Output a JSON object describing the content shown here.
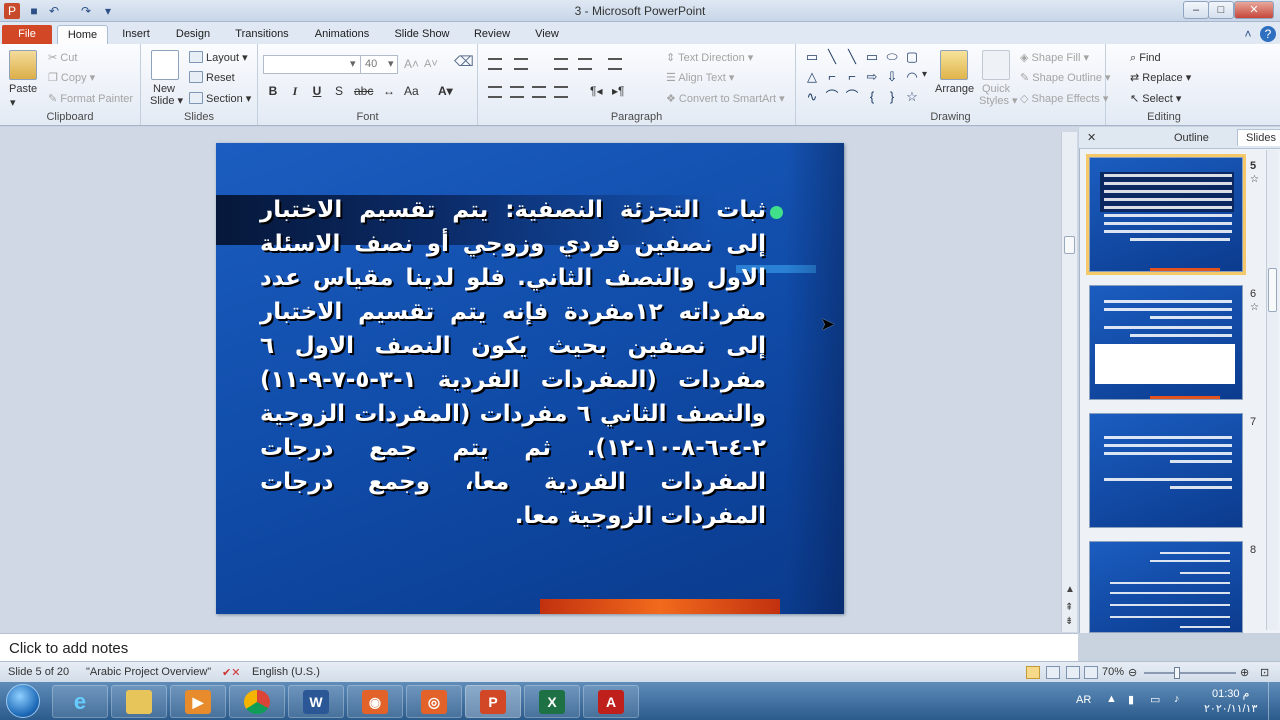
{
  "window": {
    "title": "3 - Microsoft PowerPoint",
    "minimize": "–",
    "maximize": "□",
    "close": "✕"
  },
  "tabs": [
    "File",
    "Home",
    "Insert",
    "Design",
    "Transitions",
    "Animations",
    "Slide Show",
    "Review",
    "View"
  ],
  "ribbon": {
    "clipboard": {
      "label": "Clipboard",
      "paste": "Paste",
      "cut": "Cut",
      "copy": "Copy",
      "format_painter": "Format Painter"
    },
    "slides": {
      "label": "Slides",
      "new_slide_1": "New",
      "new_slide_2": "Slide",
      "layout": "Layout",
      "reset": "Reset",
      "section": "Section"
    },
    "font": {
      "label": "Font",
      "font_name": "",
      "font_size": "40"
    },
    "paragraph": {
      "label": "Paragraph",
      "text_direction": "Text Direction",
      "align_text": "Align Text",
      "smartart": "Convert to SmartArt"
    },
    "drawing": {
      "label": "Drawing",
      "arrange": "Arrange",
      "quick_styles_1": "Quick",
      "quick_styles_2": "Styles",
      "shape_fill": "Shape Fill",
      "shape_outline": "Shape Outline",
      "shape_effects": "Shape Effects"
    },
    "editing": {
      "label": "Editing",
      "find": "Find",
      "replace": "Replace",
      "select": "Select"
    }
  },
  "slide": {
    "text": "ثبات التجزئة النصفية: يتم تقسيم الاختبار إلى نصفين فردي وزوجي أو نصف الاسئلة الاول والنصف الثاني. فلو لدينا مقياس عدد مفرداته ١٢مفردة فإنه يتم تقسيم الاختبار إلى نصفين بحيث يكون النصف الاول ٦ مفردات (المفردات الفردية ١-٣-٥-٧-٩-١١) والنصف الثاني ٦ مفردات (المفردات الزوجية ٢-٤-٦-٨-١٠-١٢). ثم يتم جمع درجات المفردات الفردية معا، وجمع درجات المفردات الزوجية معا."
  },
  "panel": {
    "tab_outline": "Outline",
    "tab_slides": "Slides",
    "close": "✕"
  },
  "thumbnails": [
    {
      "num": "5",
      "selected": true
    },
    {
      "num": "6",
      "selected": false
    },
    {
      "num": "7",
      "selected": false
    },
    {
      "num": "8",
      "selected": false
    }
  ],
  "notes": {
    "placeholder": "Click to add notes"
  },
  "status": {
    "slide_of": "Slide 5 of 20",
    "theme": "\"Arabic Project Overview\"",
    "language": "English (U.S.)",
    "zoom": "70%"
  },
  "tray": {
    "lang": "AR",
    "time": "01:30 م",
    "date": "٢٠٢٠/١١/١٣"
  },
  "colors": {
    "slide_bg": "#1558bb",
    "bullet": "#3fe089",
    "file_tab": "#d24726"
  }
}
